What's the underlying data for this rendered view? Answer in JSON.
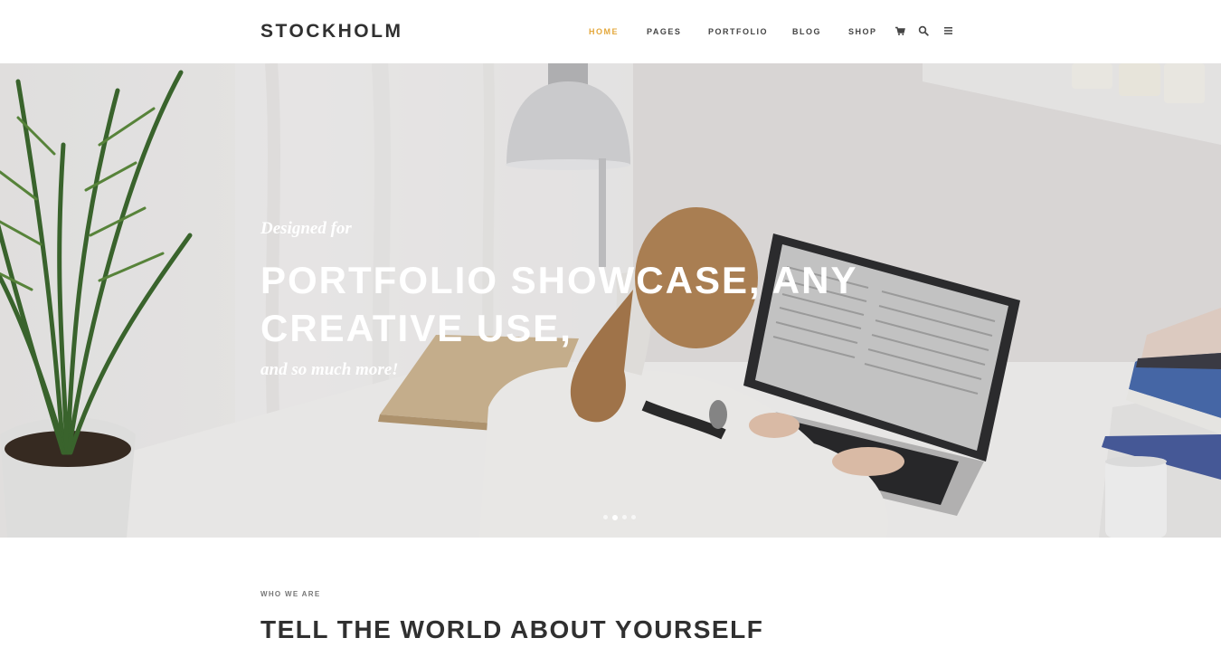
{
  "header": {
    "logo": "STOCKHOLM",
    "nav": [
      {
        "label": "HOME",
        "active": true
      },
      {
        "label": "PAGES",
        "active": false
      },
      {
        "label": "PORTFOLIO",
        "active": false
      },
      {
        "label": "BLOG",
        "active": false
      },
      {
        "label": "SHOP",
        "active": false
      }
    ],
    "icons": [
      "cart-icon",
      "search-icon",
      "menu-icon"
    ]
  },
  "hero": {
    "kicker": "Designed for",
    "title": "PORTFOLIO SHOWCASE, ANY CREATIVE USE,",
    "subtitle": "and so much more!",
    "slides": 4,
    "active_slide": 2
  },
  "section": {
    "label": "WHO WE ARE",
    "title": "TELL THE WORLD ABOUT YOURSELF"
  },
  "colors": {
    "accent": "#e4a83c",
    "text": "#303030",
    "background": "#ffffff"
  }
}
